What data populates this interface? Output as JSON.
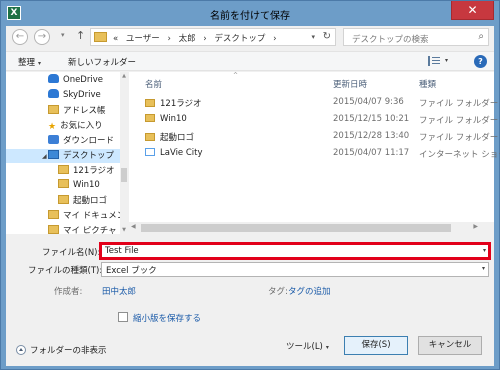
{
  "window": {
    "title": "名前を付けて保存",
    "app_icon": "X",
    "close_label": "✕"
  },
  "navigation": {
    "back_icon": "←",
    "forward_icon": "→",
    "history_icon": "▾",
    "up_icon": "↑",
    "breadcrumb": [
      "«",
      "ユーザー",
      "›",
      "太郎",
      "›",
      "デスクトップ",
      "›"
    ],
    "address_dropdown": "▾",
    "refresh_icon": "↻",
    "search_placeholder": "デスクトップの検索",
    "search_icon": "⌕"
  },
  "toolbar": {
    "organize": "整理",
    "organize_drop": "▾",
    "new_folder": "新しいフォルダー",
    "view_drop": "▾",
    "help_label": "?"
  },
  "sidebar": {
    "items": [
      {
        "label": "OneDrive",
        "icon": "cloud-icon"
      },
      {
        "label": "SkyDrive",
        "icon": "cloud-icon"
      },
      {
        "label": "アドレス帳",
        "icon": "folder-icon"
      },
      {
        "label": "お気に入り",
        "icon": "star-icon"
      },
      {
        "label": "ダウンロード",
        "icon": "download-icon"
      },
      {
        "label": "デスクトップ",
        "icon": "desktop-icon",
        "expanded": true,
        "selected": true
      },
      {
        "label": "121ラジオ",
        "icon": "folder-icon"
      },
      {
        "label": "Win10",
        "icon": "folder-icon"
      },
      {
        "label": "起動ロゴ",
        "icon": "folder-icon"
      },
      {
        "label": "マイ ドキュメント",
        "icon": "folder-icon"
      },
      {
        "label": "マイ ピクチャ",
        "icon": "folder-icon"
      }
    ],
    "star_glyph": "★",
    "caret": "◢"
  },
  "file_list": {
    "columns": {
      "name": "名前",
      "date": "更新日時",
      "type": "種類"
    },
    "sort_indicator": "^",
    "rows": [
      {
        "name": "121ラジオ",
        "date": "2015/04/07 9:36",
        "type": "ファイル フォルダー",
        "icon": "folder-icon"
      },
      {
        "name": "Win10",
        "date": "2015/12/15 10:21",
        "type": "ファイル フォルダー",
        "icon": "folder-icon"
      },
      {
        "name": "起動ロゴ",
        "date": "2015/12/28 13:40",
        "type": "ファイル フォルダー",
        "icon": "folder-icon"
      },
      {
        "name": "LaVie City",
        "date": "2015/04/07 11:17",
        "type": "インターネット ショー...",
        "icon": "internet-shortcut-icon"
      }
    ]
  },
  "form": {
    "filename_label": "ファイル名(N):",
    "filename_value": "Test File",
    "filetype_label": "ファイルの種類(T):",
    "filetype_value": "Excel ブック",
    "author_label": "作成者:",
    "author_value": "田中太郎",
    "tags_label": "タグ:",
    "tags_value": "タグの追加",
    "thumbnail_label": "縮小版を保存する",
    "dropdown_glyph": "▾"
  },
  "footer": {
    "hide_folders": "フォルダーの非表示",
    "tools": "ツール(L)",
    "save": "保存(S)",
    "cancel": "キャンセル"
  },
  "colors": {
    "title_bar": "#6d9dc8",
    "close_button": "#c7383f",
    "highlight_border": "#e2001a",
    "link": "#1a5aa8"
  }
}
